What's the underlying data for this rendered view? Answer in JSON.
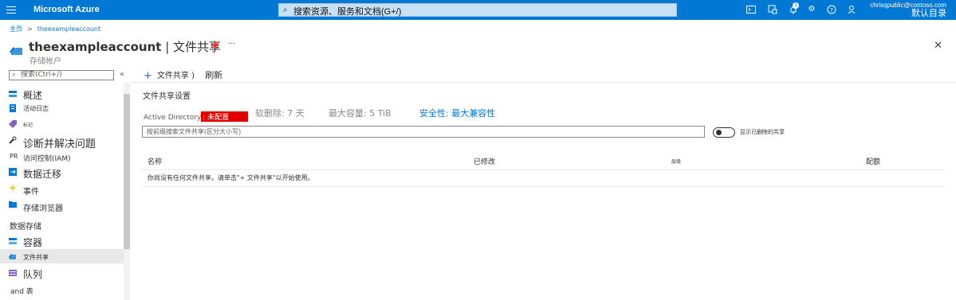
{
  "topbar": {
    "brand": "Microsoft Azure",
    "search_placeholder": "搜索资源、服务和文档(G+/)",
    "notification_count": "1",
    "user_email": "chrisqpublic@contoso.com",
    "user_directory": "默认目录"
  },
  "breadcrumb": {
    "home": "主页",
    "account": "theexampleaccount"
  },
  "header": {
    "account": "theexampleaccount",
    "separator": " | ",
    "page": "文件共享",
    "subtitle": "存储帐户"
  },
  "sidebar": {
    "search_placeholder": "搜索(Ctrl+/)",
    "collapse": "«",
    "items": [
      {
        "label": "概述",
        "icon": "overview-icon"
      },
      {
        "label": "活动日志",
        "icon": "activity-log-icon"
      },
      {
        "label": "标记",
        "icon": "tag-icon"
      },
      {
        "label": "诊断并解决问题",
        "icon": "wrench-icon"
      },
      {
        "label": "访问控制(IAM)",
        "prefix": "PR"
      },
      {
        "label": "数据迁移",
        "icon": "migration-icon"
      },
      {
        "label": "事件",
        "icon": "lightning-icon"
      },
      {
        "label": "存储浏览器",
        "icon": "storage-explorer-icon"
      }
    ],
    "section_data_storage": "数据存储",
    "storage_items": [
      {
        "label": "容器",
        "icon": "container-icon"
      },
      {
        "label": "文件共享",
        "icon": "file-share-icon"
      },
      {
        "label": "队列",
        "icon": "queue-icon"
      },
      {
        "label": "and 表",
        "icon": ""
      }
    ]
  },
  "toolbar": {
    "add_label": "文件共享",
    "add_suffix": ")",
    "refresh_label": "刷新"
  },
  "settings": {
    "heading": "文件共享设置",
    "ad_label": "Active Directory",
    "ad_value": ": 未配置",
    "soft_delete": "软删除: 7 天",
    "max_capacity": "最大容量: 5 TiB",
    "security": "安全性: 最大兼容性"
  },
  "filter": {
    "placeholder": "按前缀搜索文件共享(区分大小写)",
    "toggle_label": "显示已删除的共享"
  },
  "table": {
    "headers": [
      "名称",
      "已修改",
      "层级",
      "配额"
    ],
    "empty_message": "你尚没有任何文件共享。请单击\"+ 文件共享\"以开始使用。"
  },
  "colors": {
    "accent": "#0078d4",
    "unconfigured": "#e00000"
  }
}
